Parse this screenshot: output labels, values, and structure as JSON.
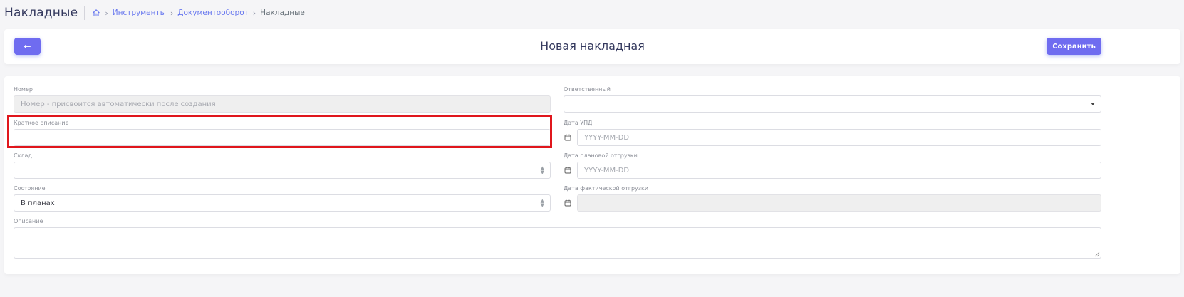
{
  "header": {
    "page_title": "Накладные",
    "breadcrumb": [
      "Инструменты",
      "Документооборот",
      "Накладные"
    ]
  },
  "toolbar": {
    "back_label": "←",
    "form_title": "Новая накладная",
    "save_label": "Сохранить"
  },
  "form": {
    "number": {
      "label": "Номер",
      "placeholder": "Номер - присвоится автоматически после создания"
    },
    "responsible": {
      "label": "Ответственный",
      "value": ""
    },
    "short_description": {
      "label": "Краткое описание",
      "value": ""
    },
    "upd_date": {
      "label": "Дата УПД",
      "placeholder": "YYYY-MM-DD"
    },
    "warehouse": {
      "label": "Склад",
      "value": ""
    },
    "planned_shipment_date": {
      "label": "Дата плановой отгрузки",
      "placeholder": "YYYY-MM-DD"
    },
    "state": {
      "label": "Состояние",
      "value": "В планах"
    },
    "actual_shipment_date": {
      "label": "Дата фактической отгрузки",
      "value": ""
    },
    "description": {
      "label": "Описание",
      "value": ""
    }
  },
  "colors": {
    "accent": "#6f6cf0",
    "highlight": "#e0161c"
  }
}
